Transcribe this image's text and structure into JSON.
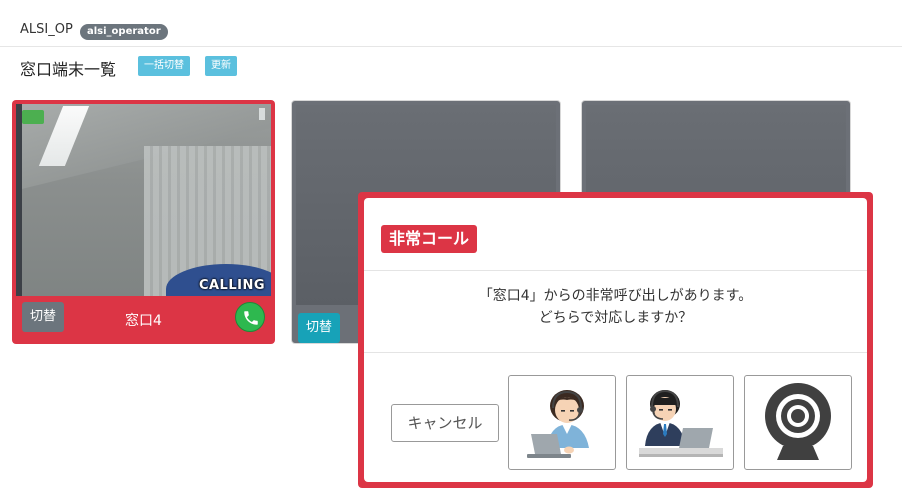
{
  "header": {
    "app_name": "ALSI_OP",
    "user_badge": "alsi_operator"
  },
  "main": {
    "title": "窓口端末一覧",
    "switch_all_label": "一括切替",
    "refresh_label": "更新"
  },
  "terminals": [
    {
      "name": "窓口4",
      "switch_label": "切替",
      "status_text": "CALLING",
      "status_color": "#dc3545"
    },
    {
      "switch_label": "切替"
    },
    {}
  ],
  "modal": {
    "title": "非常コール",
    "message_line1": "「窓口4」からの非常呼び出しがあります。",
    "message_line2": "どちらで対応しますか？",
    "cancel_label": "キャンセル",
    "choices": [
      "operator-female-icon",
      "operator-male-icon",
      "webcam-icon"
    ],
    "accent_color": "#dc3545"
  }
}
